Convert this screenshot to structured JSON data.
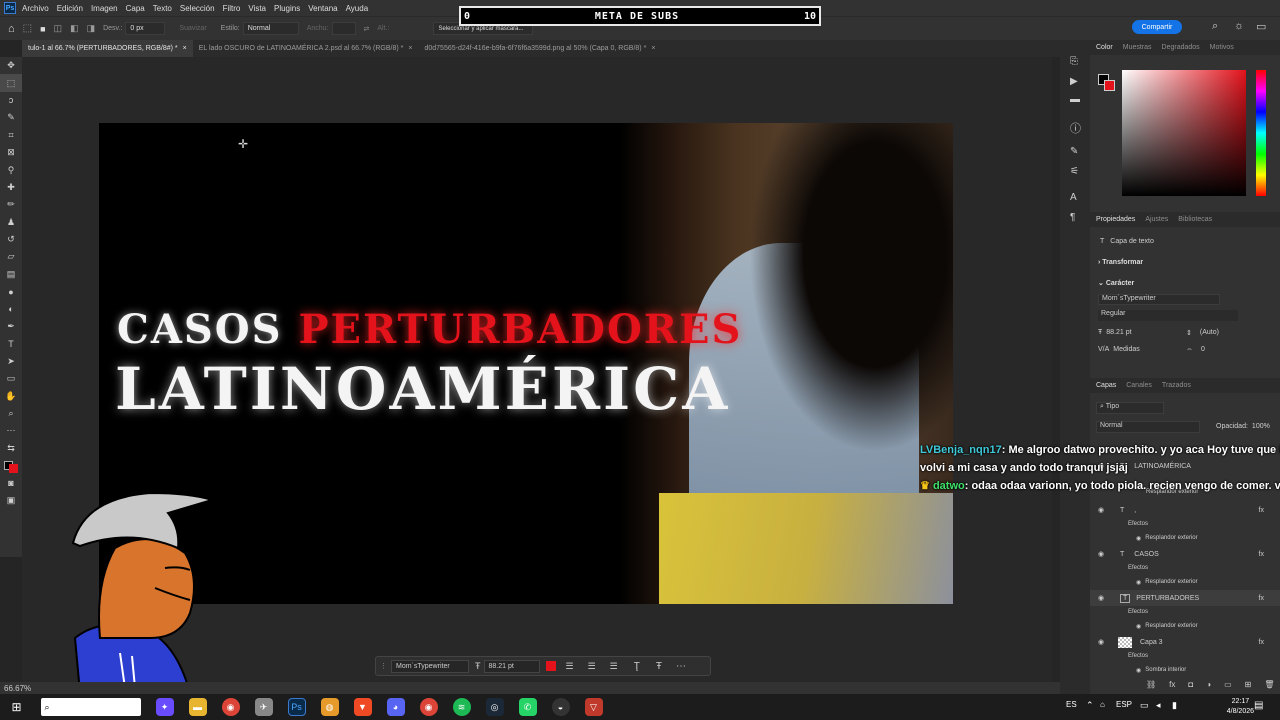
{
  "menu": [
    "Archivo",
    "Edición",
    "Imagen",
    "Capa",
    "Texto",
    "Selección",
    "Filtro",
    "Vista",
    "Plugins",
    "Ventana",
    "Ayuda"
  ],
  "options": {
    "feather_label": "Desv.:",
    "feather_value": "0 px",
    "smooth": "Suavizar",
    "style_label": "Estilo:",
    "style_value": "Normal",
    "width_label": "Anchu:",
    "height_label": "Alt.:",
    "mask_button": "Seleccionar y aplicar máscara...",
    "share": "Compartir"
  },
  "overlay": {
    "left": "0",
    "title": "META DE SUBS",
    "right": "10"
  },
  "tabs": [
    "tulo-1 al 66.7% (PERTURBADORES, RGB/8#) *",
    "EL lado OSCURO de LATINOAMÉRICA 2.psd al 66.7% (RGB/8) *",
    "d0d75565-d24f-416e-b9fa-6f76f6a3599d.png al 50% (Capa 0, RGB/8) *"
  ],
  "thumbnail": {
    "word1": "CASOS",
    "word2": "PERTURBADORES",
    "line2": "LATINOAMÉRICA"
  },
  "context_bar": {
    "font": "Mom´sTypewriter",
    "size": "88.21 pt"
  },
  "status": {
    "zoom": "66.67%"
  },
  "panel": {
    "color_tabs": [
      "Color",
      "Muestras",
      "Degradados",
      "Motivos"
    ],
    "prop_tabs": [
      "Propiedades",
      "Ajustes",
      "Bibliotecas"
    ],
    "layer_type": "Capa de texto",
    "transform": "Transformar",
    "character": "Carácter",
    "font": "Mom´sTypewriter",
    "style": "Regular",
    "size": "88.21 pt",
    "leading": "(Auto)",
    "kerning": "Medidas",
    "tracking": "0",
    "layer_tabs": [
      "Capas",
      "Canales",
      "Trazados"
    ],
    "filter": "Tipo",
    "blend": "Normal",
    "opacity_label": "Opacidad:",
    "opacity": "100%",
    "layers": [
      {
        "name": "LATINOAMÉRICA",
        "sub": "Efectos"
      },
      {
        "name": "Resplandor exterior"
      },
      {
        "name": ","
      },
      {
        "name": "Efectos"
      },
      {
        "name": "Resplandor exterior"
      },
      {
        "name": "CASOS"
      },
      {
        "name": "Efectos"
      },
      {
        "name": "Resplandor exterior"
      },
      {
        "name": "PERTURBADORES"
      },
      {
        "name": "Efectos"
      },
      {
        "name": "Resplandor exterior"
      },
      {
        "name": "Capa 3"
      },
      {
        "name": "Efectos"
      },
      {
        "name": "Sombra interior"
      }
    ]
  },
  "chat": [
    {
      "user": "LVBenja_nqn17",
      "text": ": Me algroo datwo provechito. y yo aca Hoy tuve que ir a"
    },
    {
      "user": "",
      "text": "volvi a mi casa y ando todo tranqui jsjaj"
    },
    {
      "user": "datwo",
      "text": ": odaa odaa varionn, yo todo piola. recien vengo de comer. vos"
    }
  ],
  "taskbar": {
    "lang": "ES",
    "kbd": "ESP",
    "time": "22:17",
    "date": "4/8/2026"
  },
  "colors": {
    "accent": "#1473e6",
    "red": "#e3121b",
    "chat_user1": "#3ec8d8",
    "chat_user2": "#3ee06a"
  }
}
